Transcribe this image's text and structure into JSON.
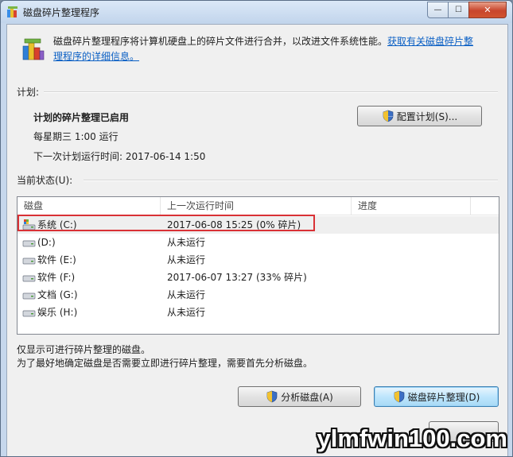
{
  "window": {
    "title": "磁盘碎片整理程序",
    "minimize_glyph": "—",
    "maximize_glyph": "☐",
    "close_glyph": "✕"
  },
  "intro": {
    "text": "磁盘碎片整理程序将计算机硬盘上的碎片文件进行合并，以改进文件系统性能。",
    "link": "获取有关磁盘碎片整理程序的详细信息。"
  },
  "schedule": {
    "section_label": "计划:",
    "status": "计划的碎片整理已启用",
    "frequency": "每星期三  1:00 运行",
    "next_run": "下一次计划运行时间: 2017-06-14 1:50",
    "configure_button": "配置计划(S)..."
  },
  "current_status": {
    "section_label": "当前状态(U):",
    "columns": [
      "磁盘",
      "上一次运行时间",
      "进度"
    ],
    "rows": [
      {
        "disk": "系统 (C:)",
        "last_run": "2017-06-08 15:25 (0% 碎片)",
        "progress": "",
        "icon": "system-drive-icon"
      },
      {
        "disk": "(D:)",
        "last_run": "从未运行",
        "progress": "",
        "icon": "drive-icon"
      },
      {
        "disk": "软件 (E:)",
        "last_run": "从未运行",
        "progress": "",
        "icon": "drive-icon"
      },
      {
        "disk": "软件 (F:)",
        "last_run": "2017-06-07 13:27 (33% 碎片)",
        "progress": "",
        "icon": "drive-icon"
      },
      {
        "disk": "文档 (G:)",
        "last_run": "从未运行",
        "progress": "",
        "icon": "drive-icon"
      },
      {
        "disk": "娱乐 (H:)",
        "last_run": "从未运行",
        "progress": "",
        "icon": "drive-icon"
      }
    ]
  },
  "notes": {
    "line1": "仅显示可进行碎片整理的磁盘。",
    "line2": "为了最好地确定磁盘是否需要立即进行碎片整理，需要首先分析磁盘。"
  },
  "actions": {
    "analyze_button": "分析磁盘(A)",
    "defrag_button": "磁盘碎片整理(D)"
  },
  "watermark": "ylmfwin100.com",
  "colors": {
    "link": "#0a5fc4",
    "highlight_box": "#d93135",
    "default_button": "#bee6fd"
  }
}
